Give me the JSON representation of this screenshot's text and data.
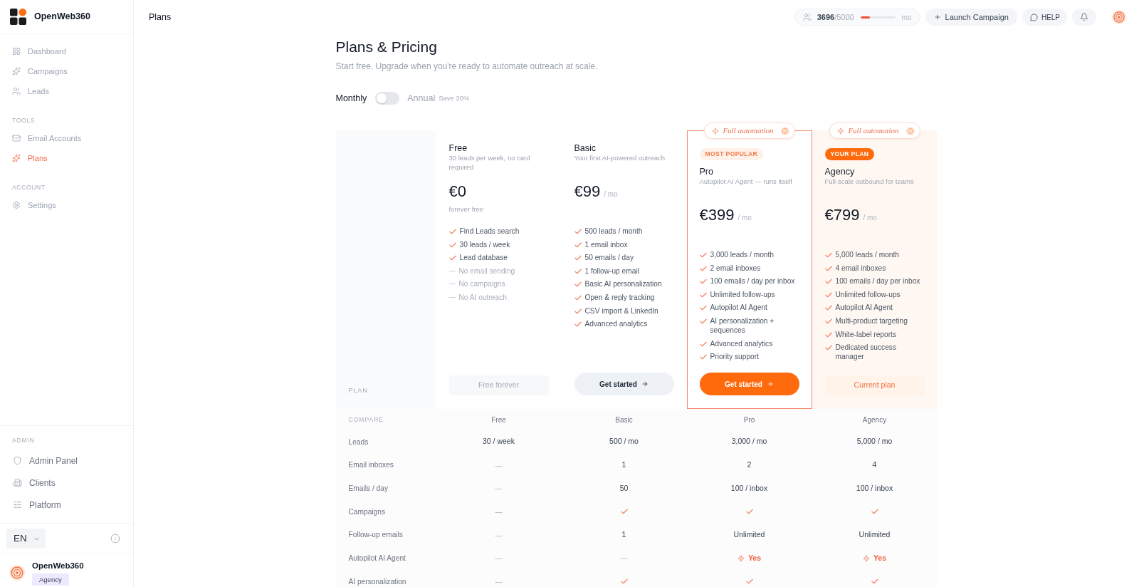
{
  "sidebar": {
    "brand": "OpenWeb360",
    "sections": [
      {
        "items": [
          {
            "label": "Dashboard",
            "selected": false
          },
          {
            "label": "Campaigns",
            "selected": false
          },
          {
            "label": "Leads",
            "selected": false
          }
        ]
      },
      {
        "title": "TOOLS",
        "items": [
          {
            "label": "Email Accounts",
            "selected": false
          },
          {
            "label": "Plans",
            "selected": true
          }
        ]
      },
      {
        "title": "ACCOUNT",
        "items": [
          {
            "label": "Settings",
            "selected": false
          }
        ]
      }
    ],
    "admin": {
      "title": "ADMIN",
      "items": [
        {
          "label": "Admin Panel"
        },
        {
          "label": "Clients"
        },
        {
          "label": "Platform"
        }
      ]
    },
    "language": "EN",
    "user": {
      "name": "OpenWeb360",
      "plan": "Agency"
    }
  },
  "topbar": {
    "title": "Plans",
    "usage": {
      "text": "**3696**/5000",
      "level": 0.27,
      "period": "mo"
    },
    "launch_button": "Launch Campaign",
    "help_button": "HELP"
  },
  "page": {
    "title": "Plans & Pricing",
    "subtitle": "Start free. Upgrade when you're ready to automate outreach at scale.",
    "billing": {
      "monthly_label": "Monthly",
      "annual_label": "Annual",
      "annual": false,
      "save_note": "Save 20%"
    }
  },
  "plans_label": "PLAN",
  "plans": [
    {
      "name": "Free",
      "description": "30 leads per week, no card required",
      "price": "€0",
      "note": "forever free",
      "highlighted": false,
      "features": [
        {
          "text": "Find Leads search",
          "included": true
        },
        {
          "text": "30 leads / week",
          "included": true
        },
        {
          "text": "Lead database",
          "included": true
        },
        {
          "text": "No email sending",
          "included": false
        },
        {
          "text": "No campaigns",
          "included": false
        },
        {
          "text": "No AI outreach",
          "included": false
        }
      ],
      "button": {
        "label": "Free forever",
        "kind": "disabled"
      }
    },
    {
      "name": "Basic",
      "description": "Your first AI-powered outreach",
      "price": "€99",
      "period": "/ mo",
      "highlighted": false,
      "features": [
        {
          "text": "500 leads / month",
          "included": true
        },
        {
          "text": "1 email inbox",
          "included": true
        },
        {
          "text": "50 emails / day",
          "included": true
        },
        {
          "text": "1 follow-up email",
          "included": true
        },
        {
          "text": "Basic AI personalization",
          "included": true
        },
        {
          "text": "Open & reply tracking",
          "included": true
        },
        {
          "text": "CSV import & LinkedIn",
          "included": true
        },
        {
          "text": "Advanced analytics",
          "included": true
        }
      ],
      "button": {
        "label": "Get started",
        "kind": "secondary"
      }
    },
    {
      "name": "Pro",
      "banner": "Full automation",
      "badge": {
        "label": "MOST POPULAR",
        "kind": "popular"
      },
      "description": "Autopilot AI Agent — runs itself",
      "price": "€399",
      "period": "/ mo",
      "highlighted": true,
      "features": [
        {
          "text": "3,000 leads / month",
          "included": true
        },
        {
          "text": "2 email inboxes",
          "included": true
        },
        {
          "text": "100 emails / day per inbox",
          "included": true
        },
        {
          "text": "Unlimited follow-ups",
          "included": true
        },
        {
          "text": "Autopilot AI Agent",
          "included": true
        },
        {
          "text": "AI personalization + sequences",
          "included": true
        },
        {
          "text": "Advanced analytics",
          "included": true
        },
        {
          "text": "Priority support",
          "included": true
        }
      ],
      "button": {
        "label": "Get started",
        "kind": "primary"
      }
    },
    {
      "name": "Agency",
      "banner": "Full automation",
      "badge": {
        "label": "YOUR PLAN",
        "kind": "current"
      },
      "description": "Full-scale outbound for teams",
      "price": "€799",
      "period": "/ mo",
      "highlighted": false,
      "features": [
        {
          "text": "5,000 leads / month",
          "included": true
        },
        {
          "text": "4 email inboxes",
          "included": true
        },
        {
          "text": "100 emails / day per inbox",
          "included": true
        },
        {
          "text": "Unlimited follow-ups",
          "included": true
        },
        {
          "text": "Autopilot AI Agent",
          "included": true
        },
        {
          "text": "Multi-product targeting",
          "included": true
        },
        {
          "text": "White-label reports",
          "included": true
        },
        {
          "text": "Dedicated success manager",
          "included": true
        }
      ],
      "button": {
        "label": "Current plan",
        "kind": "current"
      }
    }
  ],
  "compare": {
    "title": "COMPARE",
    "columns": [
      "Free",
      "Basic",
      "Pro",
      "Agency"
    ],
    "rows": [
      {
        "label": "Leads",
        "cells": [
          {
            "kind": "text",
            "text": "30 / week"
          },
          {
            "kind": "text",
            "text": "500 / mo"
          },
          {
            "kind": "text",
            "text": "3,000 / mo"
          },
          {
            "kind": "text",
            "text": "5,000 / mo"
          }
        ]
      },
      {
        "label": "Email inboxes",
        "cells": [
          {
            "kind": "none",
            "text": "—"
          },
          {
            "kind": "text",
            "text": "1"
          },
          {
            "kind": "text",
            "text": "2"
          },
          {
            "kind": "text",
            "text": "4"
          }
        ]
      },
      {
        "label": "Emails / day",
        "cells": [
          {
            "kind": "none",
            "text": "—"
          },
          {
            "kind": "text",
            "text": "50"
          },
          {
            "kind": "text",
            "text": "100 / inbox"
          },
          {
            "kind": "text",
            "text": "100 / inbox"
          }
        ]
      },
      {
        "label": "Campaigns",
        "cells": [
          {
            "kind": "none",
            "text": "—"
          },
          {
            "kind": "check"
          },
          {
            "kind": "check"
          },
          {
            "kind": "check"
          }
        ]
      },
      {
        "label": "Follow-up emails",
        "cells": [
          {
            "kind": "none",
            "text": "—"
          },
          {
            "kind": "text",
            "text": "1"
          },
          {
            "kind": "text",
            "text": "Unlimited"
          },
          {
            "kind": "text",
            "text": "Unlimited"
          }
        ]
      },
      {
        "label": "Autopilot AI Agent",
        "cells": [
          {
            "kind": "none",
            "text": "—"
          },
          {
            "kind": "none",
            "text": "—"
          },
          {
            "kind": "yes",
            "text": "Yes"
          },
          {
            "kind": "yes",
            "text": "Yes"
          }
        ]
      },
      {
        "label": "AI personalization",
        "cells": [
          {
            "kind": "none",
            "text": "—"
          },
          {
            "kind": "check"
          },
          {
            "kind": "check"
          },
          {
            "kind": "check"
          }
        ]
      }
    ]
  }
}
